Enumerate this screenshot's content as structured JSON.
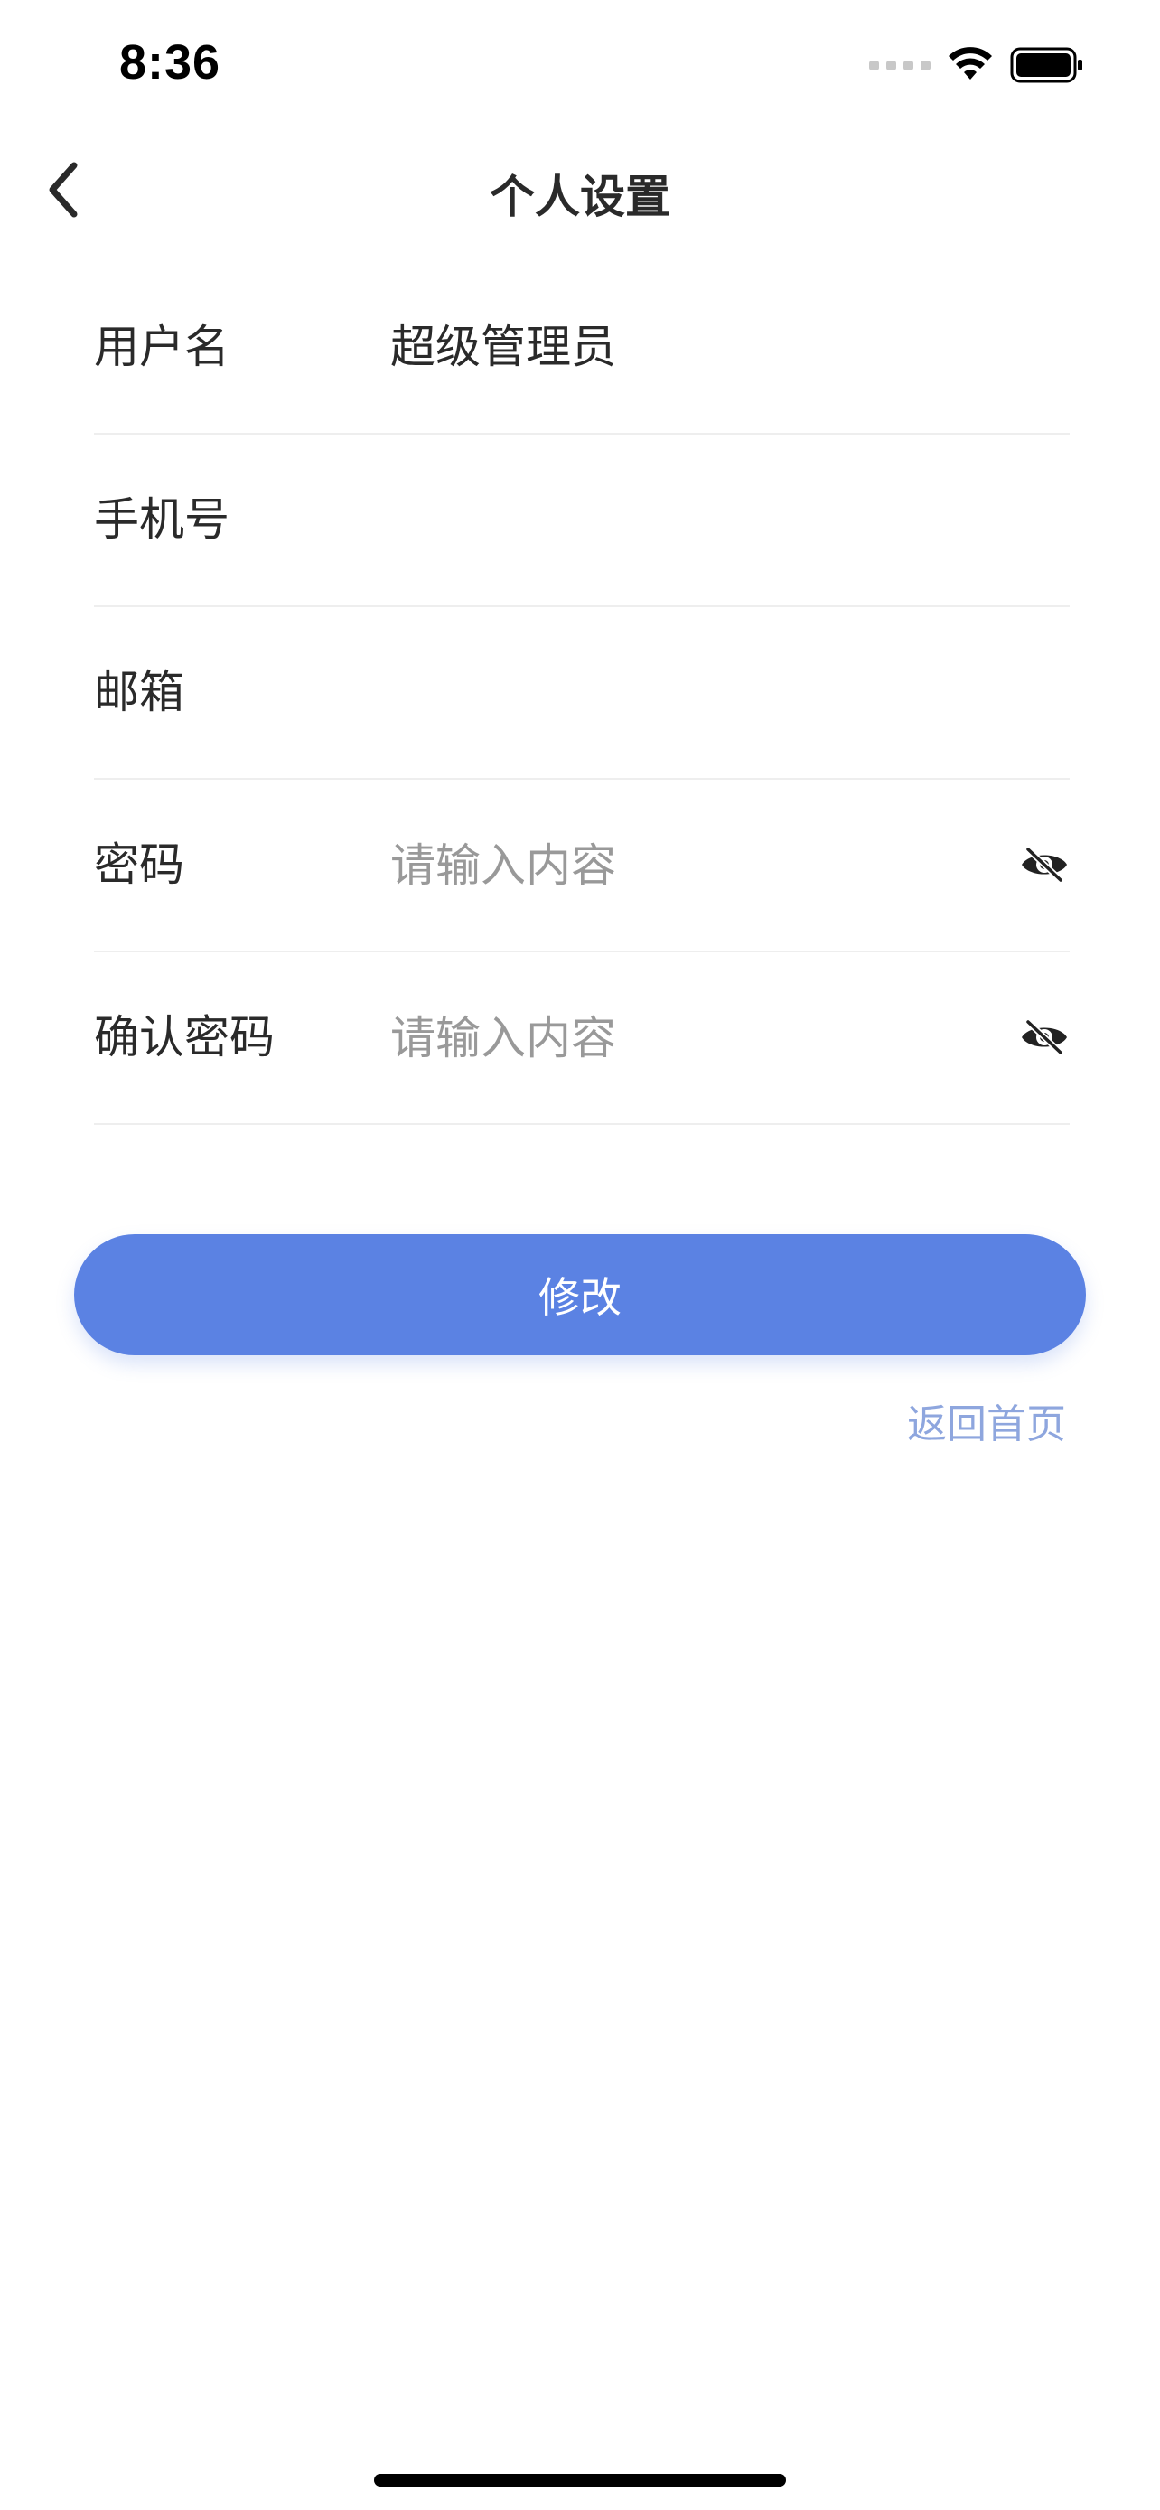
{
  "status_bar": {
    "time": "8:36"
  },
  "nav": {
    "title": "个人设置",
    "back_icon": "chevron-left-icon"
  },
  "form": {
    "username": {
      "label": "用户名",
      "value": "超级管理员"
    },
    "phone": {
      "label": "手机号",
      "value": ""
    },
    "email": {
      "label": "邮箱",
      "value": ""
    },
    "password": {
      "label": "密码",
      "placeholder": "请输入内容",
      "toggle_icon": "eye-slash-icon"
    },
    "confirm_password": {
      "label": "确认密码",
      "placeholder": "请输入内容",
      "toggle_icon": "eye-slash-icon"
    }
  },
  "actions": {
    "submit_label": "修改",
    "back_home_label": "返回首页"
  },
  "colors": {
    "primary": "#5b82e3",
    "link": "#8ea6de",
    "divider": "#eeeeee"
  }
}
